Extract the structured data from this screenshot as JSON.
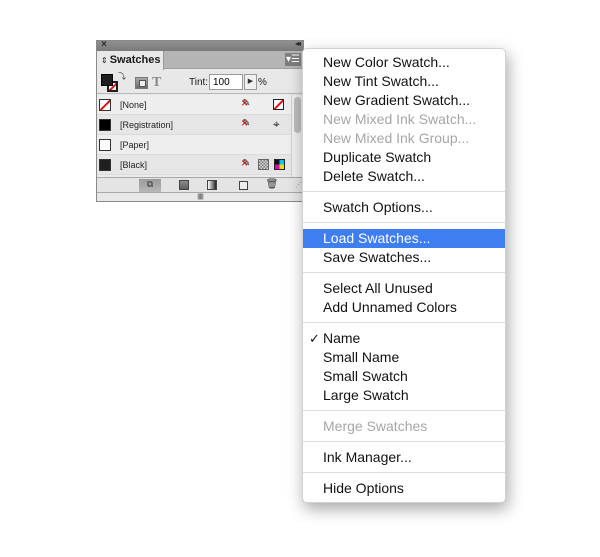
{
  "panel": {
    "close_glyph": "×",
    "collapse_glyph": "◂◂",
    "tab_arrows": "⇕",
    "tab_label": "Swatches",
    "menu_button_glyph": "▾☰",
    "tint_label": "Tint:",
    "tint_value": "100",
    "tint_stepper_glyph": "▶",
    "tint_unit": "%",
    "text_icon_glyph": "T",
    "swatches": [
      {
        "name": "[None]",
        "chip": "none",
        "icons": [
          "no-edit",
          "none-color"
        ]
      },
      {
        "name": "[Registration]",
        "chip": "registration",
        "icons": [
          "no-edit",
          "registration-mark"
        ]
      },
      {
        "name": "[Paper]",
        "chip": "paper",
        "icons": []
      },
      {
        "name": "[Black]",
        "chip": "black",
        "icons": [
          "no-edit",
          "process-color",
          "cmyk-mode"
        ]
      }
    ],
    "bottom_buttons": [
      {
        "name": "show-all-swatches",
        "glyph": "⧉"
      },
      {
        "name": "show-color-swatches"
      },
      {
        "name": "show-gradient-swatches"
      },
      {
        "name": "new-swatch"
      },
      {
        "name": "delete-swatch",
        "glyph": "🗑"
      }
    ],
    "registration_glyph": "⌖",
    "no_edit_glyph": "✎",
    "grip_glyph": "||||||||||",
    "resize_glyph": "⋰"
  },
  "menu": {
    "groups": [
      [
        {
          "label": "New Color Swatch...",
          "enabled": true
        },
        {
          "label": "New Tint Swatch...",
          "enabled": true
        },
        {
          "label": "New Gradient Swatch...",
          "enabled": true
        },
        {
          "label": "New Mixed Ink Swatch...",
          "enabled": false
        },
        {
          "label": "New Mixed Ink Group...",
          "enabled": false
        },
        {
          "label": "Duplicate Swatch",
          "enabled": true
        },
        {
          "label": "Delete Swatch...",
          "enabled": true
        }
      ],
      [
        {
          "label": "Swatch Options...",
          "enabled": true
        }
      ],
      [
        {
          "label": "Load Swatches...",
          "enabled": true,
          "highlighted": true
        },
        {
          "label": "Save Swatches...",
          "enabled": true
        }
      ],
      [
        {
          "label": "Select All Unused",
          "enabled": true
        },
        {
          "label": "Add Unnamed Colors",
          "enabled": true
        }
      ],
      [
        {
          "label": "Name",
          "enabled": true,
          "checked": true
        },
        {
          "label": "Small Name",
          "enabled": true
        },
        {
          "label": "Small Swatch",
          "enabled": true
        },
        {
          "label": "Large Swatch",
          "enabled": true
        }
      ],
      [
        {
          "label": "Merge Swatches",
          "enabled": false
        }
      ],
      [
        {
          "label": "Ink Manager...",
          "enabled": true
        }
      ],
      [
        {
          "label": "Hide Options",
          "enabled": true
        }
      ]
    ],
    "check_glyph": "✓",
    "highlight_color": "#3f7ef0",
    "disabled_color": "#a6a6a6"
  }
}
